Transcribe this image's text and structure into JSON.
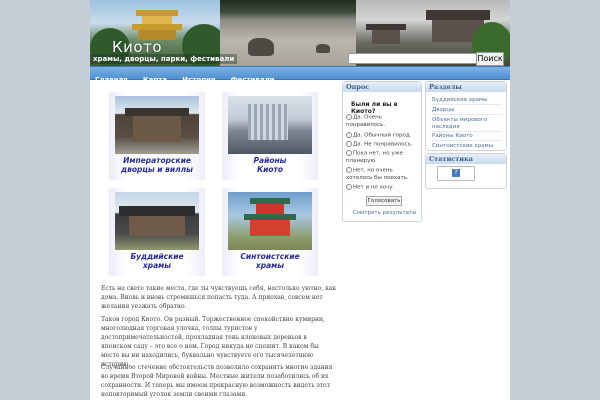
{
  "header": {
    "site_title": "Киото",
    "tagline": "храмы, дворцы, парки, фестивали",
    "search_placeholder": "",
    "search_button": "Поиск"
  },
  "nav": {
    "items": [
      "Главная",
      "Карта",
      "История",
      "Фестивали"
    ]
  },
  "content": {
    "tiles": [
      {
        "caption_line1": "Императорские",
        "caption_line2": "дворцы и виллы",
        "icon": "palace-photo"
      },
      {
        "caption_line1": "Районы",
        "caption_line2": "Киото",
        "icon": "station-photo"
      },
      {
        "caption_line1": "Буддийские",
        "caption_line2": "храмы",
        "icon": "buddhist-temple-photo"
      },
      {
        "caption_line1": "Синтоистские",
        "caption_line2": "храмы",
        "icon": "shinto-shrine-photo"
      }
    ],
    "paragraphs": [
      "Есть на свете такие места, где ты чувствуешь себя, настолько уютно, как дома. Вновь и вновь стремишься попасть туда. А приехав, совсем нет желания уезжать обратно.",
      "Таков город Киото. Он разный. Торжественное спокойствие кумирни, многолюдная торговая улочка, толпы туристов у достопримечательностей, прохладная тень кленовых деревьев в японском саду – это все о нем. Город никуда не спешит. В каком бы месте вы ни находились, буквально чувствуете его тысячелетнюю историю.",
      "Случайное стечение обстоятельств позволило сохранить многие здания во время Второй Мировой войны. Местные жители позаботились об их сохранности. И теперь мы имеем прекрасную возможность видеть этот неповторимый уголок земли своими глазами."
    ]
  },
  "poll": {
    "title": "Опрос",
    "question": "Были ли вы в Киото?",
    "options": [
      "Да. Очень понравилось.",
      "Да. Обычный город.",
      "Да. Не понравилось.",
      "Пока нет, но уже планирую.",
      "Нет, но очень хотелось бы поехать.",
      "Нет и не хочу."
    ],
    "vote_button": "Голосовать",
    "results_link": "Смотреть результаты"
  },
  "categories": {
    "title": "Разделы",
    "items": [
      "Буддийские храмы",
      "Дворцы",
      "Объекты мирового наследия",
      "Районы Киото",
      "Синтоистские храмы"
    ]
  },
  "stats": {
    "title": "Статистика",
    "counter_icon": "?"
  },
  "colors": {
    "nav_bg": "#5a98d6",
    "link": "#4a6d9a",
    "caption": "#2a2a9c",
    "page_bg": "#c5cdd6"
  }
}
